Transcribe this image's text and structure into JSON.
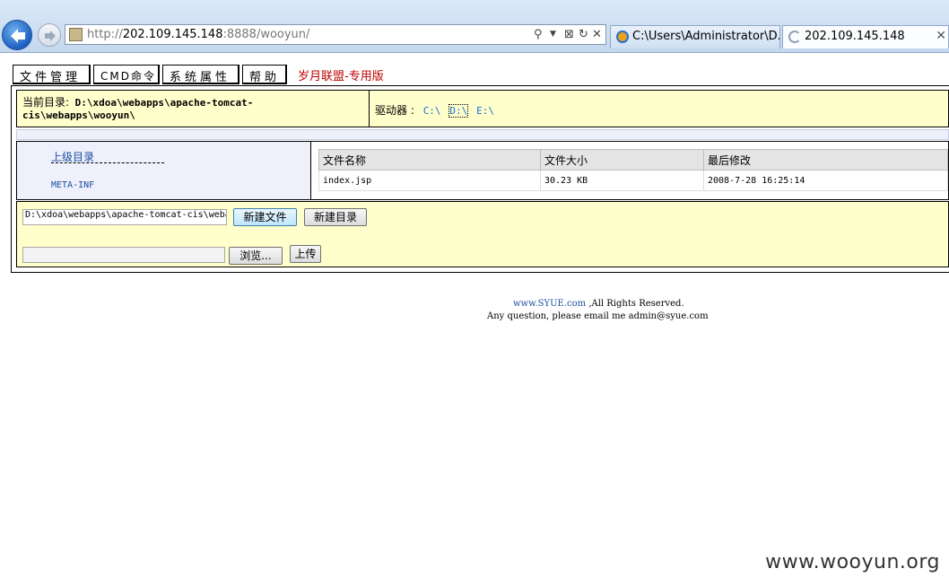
{
  "browser": {
    "url_prefix": "http://",
    "url_host": "202.109.145.148",
    "url_rest": ":8888/wooyun/",
    "tabs": [
      {
        "label": "C:\\Users\\Administrator\\D..."
      },
      {
        "label": "202.109.145.148"
      }
    ],
    "icons": [
      "back-arrow-icon",
      "forward-arrow-icon",
      "search-icon",
      "dropdown-icon",
      "compat-icon",
      "refresh-icon",
      "stop-icon",
      "close-icon"
    ]
  },
  "nav": {
    "file_manager": "文件管理",
    "cmd": "CMD命令",
    "system": "系统属性",
    "help": "帮助",
    "brand": "岁月联盟-专用版"
  },
  "current_dir": {
    "label": "当前目录:",
    "path": " D:\\xdoa\\webapps\\apache-tomcat-cis\\webapps\\wooyun\\"
  },
  "drives": {
    "label": "驱动器 :",
    "items": [
      "C:\\",
      "D:\\",
      "E:\\"
    ]
  },
  "tree": {
    "parent": "上级目录",
    "dashes": "- - - - - - - - - - - -",
    "folders": [
      "META-INF"
    ]
  },
  "file_table": {
    "headers": [
      "文件名称",
      "文件大小",
      "最后修改"
    ],
    "rows": [
      {
        "name": "index.jsp",
        "size": "30.23 KB",
        "modified": "2008-7-28 16:25:14"
      }
    ]
  },
  "actions": {
    "path_value": "D:\\xdoa\\webapps\\apache-tomcat-cis\\webapps\\wooyun\\",
    "new_file": "新建文件",
    "new_dir": "新建目录",
    "browse": "浏览...",
    "upload": "上传"
  },
  "footer": {
    "site": "www.SYUE.com",
    "rights": " ,All Rights Reserved.",
    "contact": "Any question, please email me admin@syue.com"
  },
  "watermark": "www.wooyun.org",
  "colors": {
    "panel_yellow": "#ffffcc",
    "panel_lavender": "#eef0fb",
    "brand_red": "#c00000",
    "link_blue": "#1a6fd6"
  }
}
